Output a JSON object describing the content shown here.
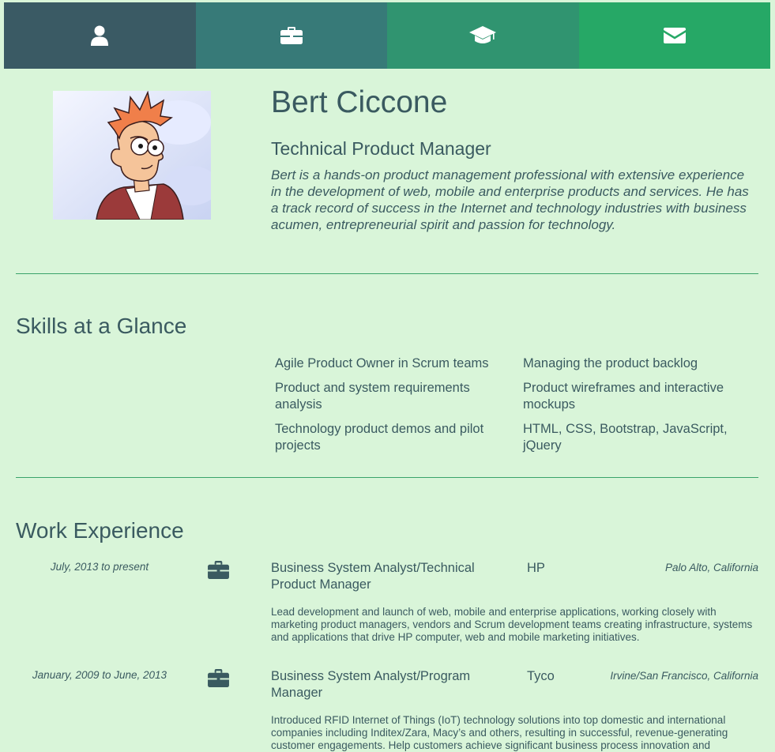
{
  "nav": {
    "tabs": [
      {
        "icon": "user-icon",
        "color": "#3a5a64"
      },
      {
        "icon": "briefcase-icon",
        "color": "#377a78"
      },
      {
        "icon": "graduation-cap-icon",
        "color": "#309470"
      },
      {
        "icon": "envelope-icon",
        "color": "#26a866"
      }
    ]
  },
  "profile": {
    "name": "Bert Ciccone",
    "title": "Technical Product Manager",
    "summary": "Bert is a hands-on product management professional with extensive experience in the development of web, mobile and enterprise products and services. He has a track record of success in the Internet and technology industries with business acumen, entrepreneurial spirit and passion for technology."
  },
  "skills": {
    "heading": "Skills at a Glance",
    "items": [
      "Agile Product Owner in Scrum teams",
      "Managing the product backlog",
      "Product and system requirements analysis",
      "Product wireframes and interactive mockups",
      "Technology product demos and pilot projects",
      "HTML, CSS, Bootstrap, JavaScript, jQuery"
    ]
  },
  "experience": {
    "heading": "Work Experience",
    "jobs": [
      {
        "dates": "July, 2013 to present",
        "icon": "briefcase-icon",
        "title": "Business System Analyst/Technical Product Manager",
        "company": "HP",
        "location": "Palo Alto, California",
        "description": "Lead development and launch of web, mobile and enterprise applications, working closely with marketing product managers, vendors and Scrum development teams creating infrastructure, systems and applications that drive HP computer, web and mobile marketing initiatives."
      },
      {
        "dates": "January, 2009 to June, 2013",
        "icon": "briefcase-icon",
        "title": "Business System Analyst/Program Manager",
        "company": "Tyco",
        "location": "Irvine/San Francisco, California",
        "description": "Introduced RFID Internet of Things (IoT) technology solutions into top domestic and international companies including Inditex/Zara, Macy’s and others, resulting in successful, revenue-generating customer engagements. Help customers achieve significant business process innovation and"
      }
    ]
  },
  "colors": {
    "background": "#d9f5d9",
    "text": "#3a5a60",
    "divider": "#3aa36a"
  }
}
